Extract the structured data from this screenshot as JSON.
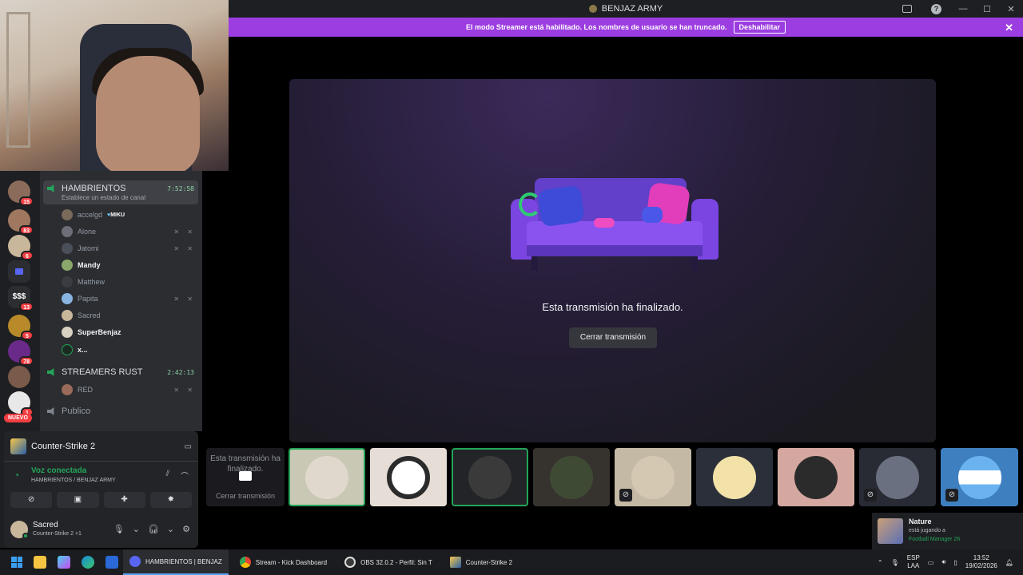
{
  "window": {
    "title": "BENJAZ ARMY",
    "actions": [
      "inbox-icon",
      "help-icon",
      "minimize-icon",
      "maximize-icon",
      "close-icon"
    ]
  },
  "banner": {
    "text": "El modo Streamer está habilitado. Los nombres de usuario se han truncado.",
    "button": "Deshabilitar",
    "close": "✕"
  },
  "rail": {
    "servers": [
      {
        "badge": "15"
      },
      {
        "badge": "83"
      },
      {
        "badge": "6"
      },
      {
        "type": "folder",
        "badge": ""
      },
      {
        "type": "money",
        "label": "$$$",
        "badge": "13"
      },
      {
        "badge": "5"
      },
      {
        "badge": "78"
      },
      {
        "badge": ""
      },
      {
        "badge": "1"
      }
    ],
    "nuevo": "NUEVO"
  },
  "channels": {
    "hambrientos": {
      "name": "HAMBRIENTOS",
      "time": "7:52:58",
      "status": "Establece un estado de canal"
    },
    "members": [
      {
        "name": "accelgd",
        "tag": "MIKU",
        "icons": ""
      },
      {
        "name": "Alone",
        "icons": "✕ ✕"
      },
      {
        "name": "Jatomi",
        "icons": "✕ ✕"
      },
      {
        "name": "Mandy",
        "bright": true,
        "icons": ""
      },
      {
        "name": "Matthew",
        "icons": ""
      },
      {
        "name": "Papita",
        "icons": "✕ ✕"
      },
      {
        "name": "Sacred",
        "icons": ""
      },
      {
        "name": "SuperBenjaz",
        "bright": true,
        "icons": ""
      },
      {
        "name": "x...",
        "bright": true,
        "icons": ""
      }
    ],
    "rust": {
      "name": "STREAMERS RUST",
      "time": "2:42:13"
    },
    "rust_members": [
      {
        "name": "RED",
        "icons": "✕ ✕"
      }
    ],
    "publico": "Publico"
  },
  "panel": {
    "game": "Counter-Strike 2",
    "voice_title": "Voz conectada",
    "voice_sub": "HAMBRIENTOS / BENJAZ ARMY",
    "user_name": "Sacred",
    "user_sub": "Counter-Strike 2 +1"
  },
  "stream": {
    "ended": "Esta transmisión ha finalizado.",
    "close_button": "Cerrar transmisión"
  },
  "mini": {
    "text": "Esta transmisión ha finalizado.",
    "button": "Cerrar transmisión"
  },
  "toast": {
    "name": "Nature",
    "sub": "está jugando a",
    "game": "Football Manager 26"
  },
  "taskbar": {
    "apps": [
      "HAMBRIENTOS | BENJAZ",
      "Stream - Kick Dashboard",
      "OBS 32.0.2 - Perfil: Sin T",
      "Counter-Strike 2"
    ],
    "lang1": "ESP",
    "lang2": "LAA",
    "time": "13:52",
    "date": "19/02/2026"
  },
  "colors": {
    "accent": "#5865f2",
    "banner": "#9b3de0",
    "online": "#23a559",
    "badge": "#f23f43"
  }
}
